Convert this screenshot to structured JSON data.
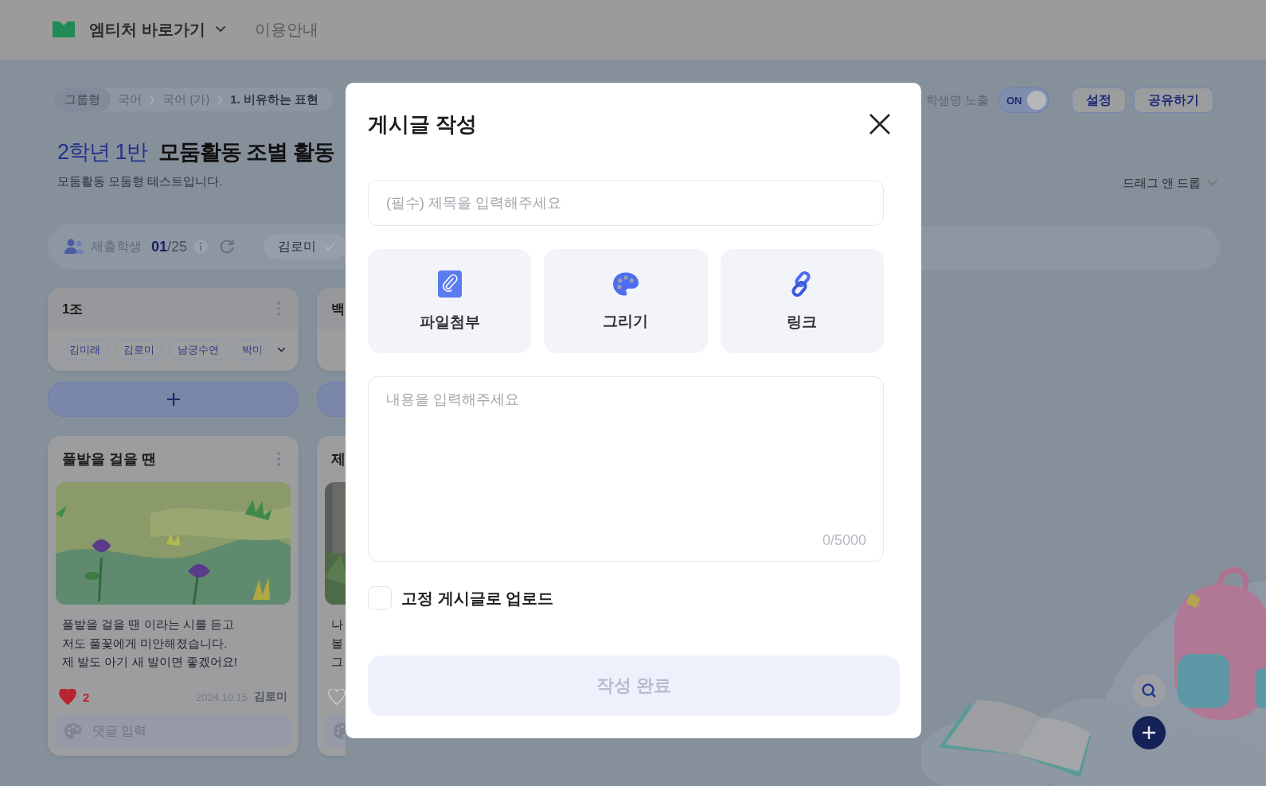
{
  "header": {
    "brand": "엠티처 바로가기",
    "nav": [
      {
        "label": "이용안내"
      }
    ]
  },
  "breadcrumb": {
    "type": "그룹형",
    "path": [
      "국어",
      "국어 (가)",
      "1. 비유하는 표현"
    ]
  },
  "title": {
    "class_name": "2학년 1반",
    "activity": "모둠활동 조별 활동",
    "description": "모둠활동 모둠형 테스트입니다."
  },
  "controls": {
    "name_label": "학생명 노출",
    "name_toggle": {
      "label": "ON",
      "on": true
    },
    "buttons": [
      {
        "label": "설정"
      },
      {
        "label": "공유하기"
      }
    ],
    "sort": "드래그 앤 드롭"
  },
  "submission": {
    "label": "제출학생",
    "count": "01",
    "total": "/25",
    "filter": "김로미"
  },
  "columns": [
    {
      "title": "1조",
      "members": [
        "김미래",
        "김로미",
        "남궁수연",
        "박미"
      ],
      "posts": [
        {
          "title": "풀밭을 걸을 땐",
          "body": "풀밭을 걸을 땐 이라는 시를 듣고\n저도 풀꽃에게 미안해졌습니다.\n제 발도 아기 새 발이면 좋겠어요!",
          "liked": true,
          "likes": "2",
          "date": "2024.10.15",
          "author": "김로미",
          "comment_placeholder": "댓글 입력"
        }
      ]
    },
    {
      "title": "백",
      "posts": [
        {
          "title": "제",
          "body": "나\n볼\n그",
          "liked": false
        }
      ]
    }
  ],
  "modal": {
    "title": "게시글 작성",
    "title_field": {
      "placeholder": "(필수) 제목을 입력해주세요"
    },
    "attachments": [
      {
        "label": "파일첨부",
        "kind": "file"
      },
      {
        "label": "그리기",
        "kind": "draw"
      },
      {
        "label": "링크",
        "kind": "link"
      }
    ],
    "content_field": {
      "placeholder": "내용을 입력해주세요",
      "counter": "0/5000"
    },
    "pin": {
      "label": "고정 게시글로 업로드",
      "checked": false
    },
    "submit": {
      "label": "작성 완료",
      "disabled": true
    }
  }
}
